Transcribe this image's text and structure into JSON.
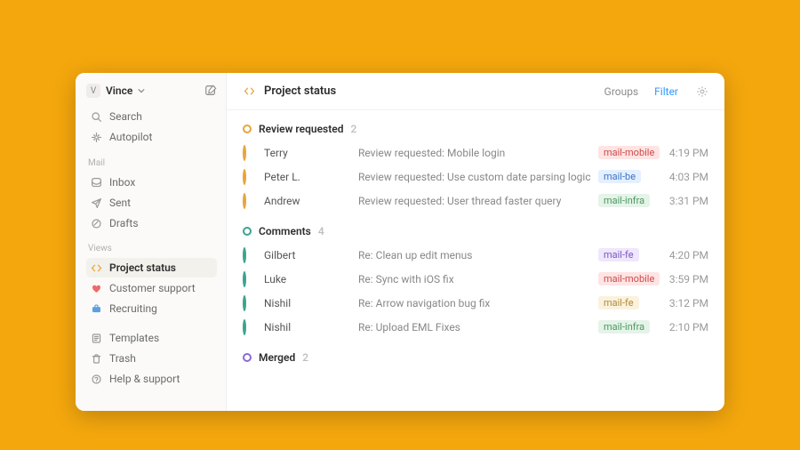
{
  "user": {
    "initial": "V",
    "name": "Vince"
  },
  "sidebar": {
    "top": [
      {
        "label": "Search",
        "icon": "search"
      },
      {
        "label": "Autopilot",
        "icon": "sparkle"
      }
    ],
    "sections": [
      {
        "label": "Mail",
        "items": [
          {
            "label": "Inbox",
            "icon": "inbox"
          },
          {
            "label": "Sent",
            "icon": "send"
          },
          {
            "label": "Drafts",
            "icon": "draft"
          }
        ]
      },
      {
        "label": "Views",
        "items": [
          {
            "label": "Project status",
            "icon": "code",
            "active": true
          },
          {
            "label": "Customer support",
            "icon": "heart"
          },
          {
            "label": "Recruiting",
            "icon": "briefcase"
          }
        ]
      }
    ],
    "bottom": [
      {
        "label": "Templates",
        "icon": "templates"
      },
      {
        "label": "Trash",
        "icon": "trash"
      },
      {
        "label": "Help & support",
        "icon": "help"
      }
    ]
  },
  "header": {
    "title": "Project status",
    "actions": {
      "groups": "Groups",
      "filter": "Filter"
    }
  },
  "groups": [
    {
      "name": "Review requested",
      "count": 2,
      "status": "amber",
      "rows": [
        {
          "sender": "Terry",
          "subject": "Review requested: Mobile login",
          "tag": "mail-mobile",
          "tag_color": "red",
          "time": "4:19 PM"
        },
        {
          "sender": "Peter L.",
          "subject": "Review requested: Use custom date parsing logic",
          "tag": "mail-be",
          "tag_color": "blue",
          "time": "4:03 PM"
        },
        {
          "sender": "Andrew",
          "subject": "Review requested: User thread faster query",
          "tag": "mail-infra",
          "tag_color": "green",
          "time": "3:31 PM"
        }
      ]
    },
    {
      "name": "Comments",
      "count": 4,
      "status": "teal",
      "rows": [
        {
          "sender": "Gilbert",
          "subject": "Re: Clean up edit menus",
          "tag": "mail-fe",
          "tag_color": "purple",
          "time": "4:20 PM"
        },
        {
          "sender": "Luke",
          "subject": "Re: Sync with iOS fix",
          "tag": "mail-mobile",
          "tag_color": "red",
          "time": "3:59 PM"
        },
        {
          "sender": "Nishil",
          "subject": "Re: Arrow navigation bug fix",
          "tag": "mail-fe",
          "tag_color": "yellow",
          "time": "3:12 PM"
        },
        {
          "sender": "Nishil",
          "subject": "Re: Upload EML Fixes",
          "tag": "mail-infra",
          "tag_color": "green",
          "time": "2:10 PM"
        }
      ]
    },
    {
      "name": "Merged",
      "count": 2,
      "status": "violet",
      "rows": []
    }
  ]
}
